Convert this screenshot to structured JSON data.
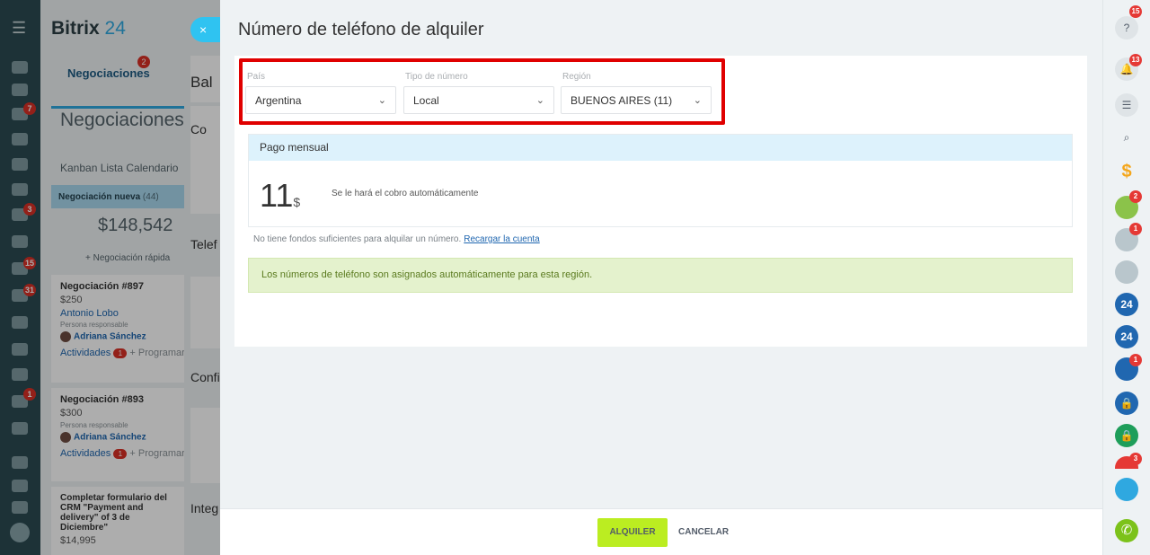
{
  "app": {
    "brand": "Bitrix",
    "brand_suffix": "24",
    "menu_glyph": "☰"
  },
  "crm": {
    "tab_label": "Negociaciones",
    "tab_badge": "2",
    "page_title": "Negociaciones",
    "views": "Kanban  Lista  Calendario",
    "stage_name": "Negociación nueva",
    "stage_count": "(44)",
    "stage_total": "$148,542",
    "quick_add": "+ Negociación rápida",
    "cards": [
      {
        "title": "Negociación #897",
        "amount": "$250",
        "client": "Antonio Lobo",
        "resp_label": "Persona responsable",
        "resp_name": "Adriana Sánchez",
        "activities": "Actividades",
        "activities_count": "1",
        "plan": "+ Programar"
      },
      {
        "title": "Negociación #893",
        "amount": "$300",
        "resp_label": "Persona responsable",
        "resp_name": "Adriana Sánchez",
        "activities": "Actividades",
        "activities_count": "1",
        "plan": "+ Programar"
      },
      {
        "title": "Completar formulario del CRM \"Payment and delivery\" of 3 de Diciembre\"",
        "amount": "$14,995"
      }
    ]
  },
  "secondary": {
    "labels": [
      "Bal",
      "Co",
      "Telef",
      "Confi",
      "Integ"
    ]
  },
  "left_badges": [
    "7",
    "3",
    "15",
    "31",
    "1"
  ],
  "slider": {
    "close_glyph": "×",
    "title": "Número de teléfono de alquiler",
    "country": {
      "label": "País",
      "value": "Argentina"
    },
    "number_type": {
      "label": "Tipo de número",
      "value": "Local"
    },
    "region": {
      "label": "Región",
      "value": "BUENOS AIRES (11)"
    },
    "chevron": "⌄",
    "payment": {
      "header": "Pago mensual",
      "amount": "11",
      "currency": "$",
      "note": "Se le hará el cobro automáticamente"
    },
    "funds_text": "No tiene fondos suficientes para alquilar un número.",
    "recharge_link": "Recargar la cuenta",
    "assigned_text": "Los números de teléfono son asignados automáticamente para esta región.",
    "ok_label": "ALQUILER",
    "cancel_label": "CANCELAR"
  },
  "rightbar": {
    "help_glyph": "?",
    "help_badge": "15",
    "notif_glyph": "🔔",
    "notif_badge": "13",
    "chat_glyph": "☰",
    "search_glyph": "⌕",
    "money_glyph": "$",
    "calendar_badge": "2",
    "group_badge": "1",
    "b24_label": "24",
    "users_badge": "1",
    "lock_glyph": "🔒",
    "last_badge": "3",
    "phone_glyph": "✆"
  },
  "colors": {
    "highlight": "#e00000",
    "accent_button": "#bbed21",
    "info_bg": "#ddf2fc",
    "success_bg": "#e4f2cd"
  }
}
